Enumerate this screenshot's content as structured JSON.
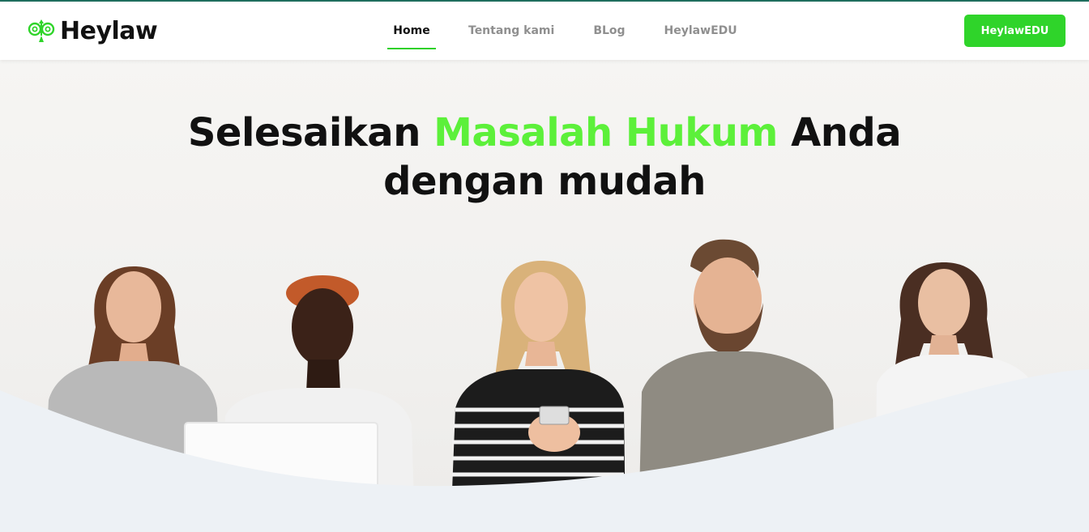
{
  "brand": {
    "name": "Heylaw",
    "logo_icon": "clover-scales-icon",
    "accent_color": "#2fd42a",
    "headline_accent_color": "#5cf03a"
  },
  "nav": {
    "items": [
      {
        "label": "Home",
        "active": true
      },
      {
        "label": "Tentang kami",
        "active": false
      },
      {
        "label": "BLog",
        "active": false
      },
      {
        "label": "HeylawEDU",
        "active": false
      }
    ]
  },
  "cta": {
    "label": "HeylawEDU"
  },
  "hero": {
    "headline_part1": "Selesaikan ",
    "headline_accent": "Masalah Hukum",
    "headline_part2": " Anda",
    "headline_line2": "dengan mudah",
    "image_description_icon": "group-of-people-looking-up-image"
  }
}
